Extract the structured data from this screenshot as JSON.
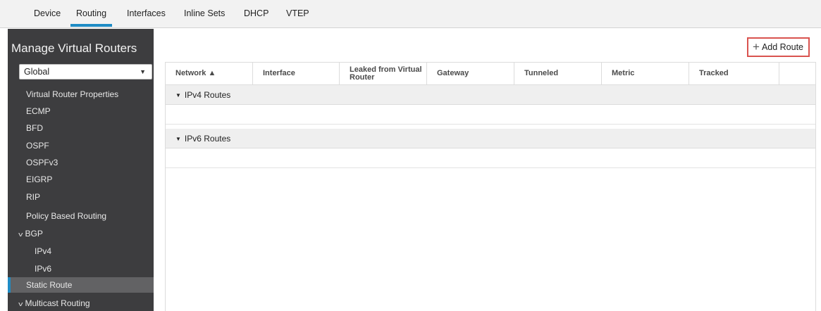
{
  "tabs": [
    {
      "label": "Device"
    },
    {
      "label": "Routing"
    },
    {
      "label": "Interfaces"
    },
    {
      "label": "Inline Sets"
    },
    {
      "label": "DHCP"
    },
    {
      "label": "VTEP"
    }
  ],
  "active_tab": "Routing",
  "sidebar": {
    "title": "Manage Virtual Routers",
    "router_select": {
      "value": "Global",
      "icon": "caret-down-icon"
    },
    "items": [
      {
        "label": "Virtual Router Properties"
      },
      {
        "label": "ECMP"
      },
      {
        "label": "BFD"
      },
      {
        "label": "OSPF"
      },
      {
        "label": "OSPFv3"
      },
      {
        "label": "EIGRP"
      },
      {
        "label": "RIP"
      },
      {
        "label": "Policy Based Routing"
      },
      {
        "label": "BGP",
        "icon": "chevron-down-icon"
      },
      {
        "label": "IPv4"
      },
      {
        "label": "IPv6"
      },
      {
        "label": "Static Route"
      },
      {
        "label": "Multicast Routing",
        "icon": "chevron-down-icon"
      }
    ],
    "active_item": "Static Route"
  },
  "toolbar": {
    "add_route_label": "Add Route",
    "add_icon": "plus-icon"
  },
  "table": {
    "columns": [
      {
        "label": "Network ▲"
      },
      {
        "label": "Interface"
      },
      {
        "label": "Leaked from Virtual Router"
      },
      {
        "label": "Gateway"
      },
      {
        "label": "Tunneled"
      },
      {
        "label": "Metric"
      },
      {
        "label": "Tracked"
      }
    ],
    "groups": [
      {
        "label": "IPv4 Routes",
        "icon": "triangle-down-icon"
      },
      {
        "label": "IPv6 Routes",
        "icon": "triangle-down-icon"
      }
    ]
  },
  "colors": {
    "accent": "#1f8cc5",
    "highlight_border": "#d9534f",
    "sidebar_bg": "#3d3d3f"
  }
}
